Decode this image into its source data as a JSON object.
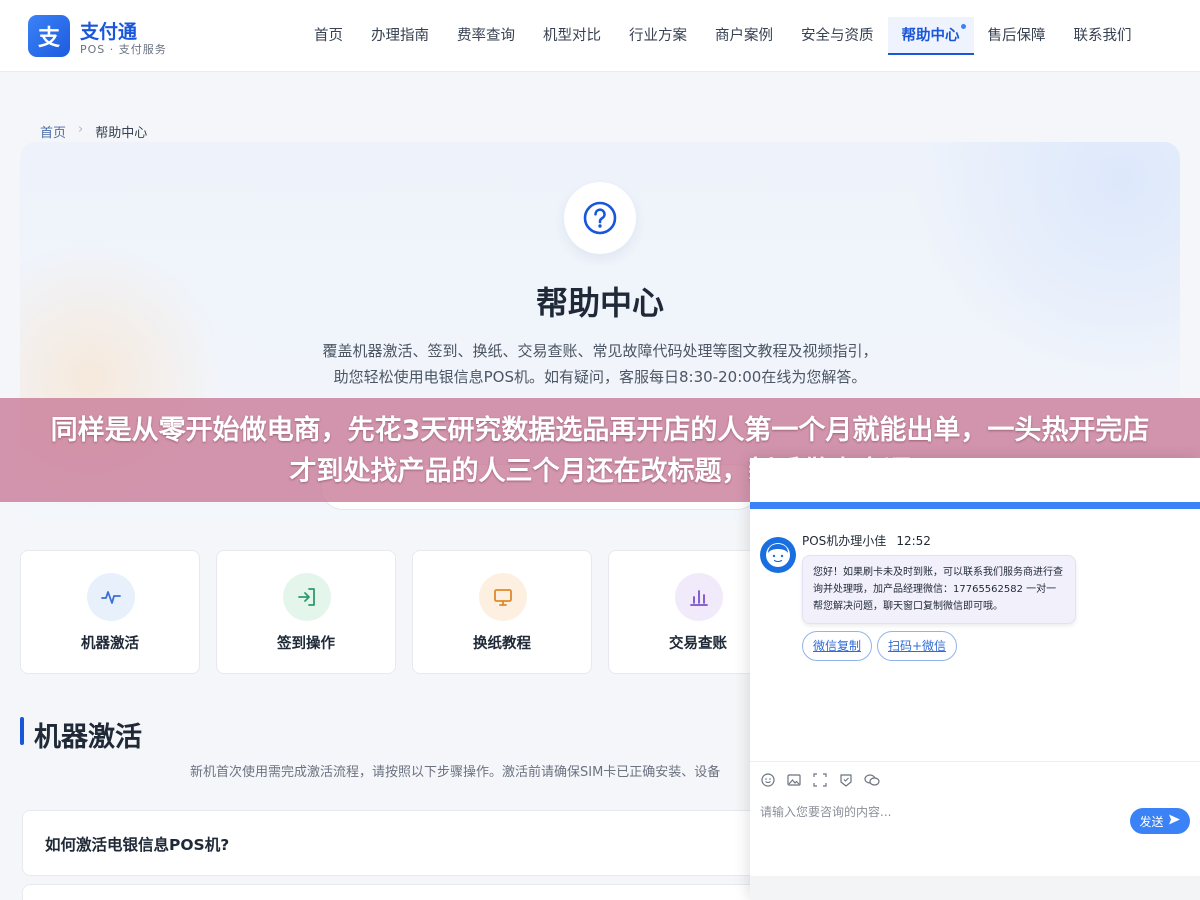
{
  "header": {
    "logo_glyph": "支",
    "logo_title": "支付通",
    "logo_subtitle": "POS · 支付服务",
    "nav": [
      {
        "label": "首页"
      },
      {
        "label": "办理指南"
      },
      {
        "label": "费率查询"
      },
      {
        "label": "机型对比"
      },
      {
        "label": "行业方案"
      },
      {
        "label": "商户案例"
      },
      {
        "label": "安全与资质"
      },
      {
        "label": "帮助中心",
        "active": true
      },
      {
        "label": "售后保障"
      },
      {
        "label": "联系我们"
      }
    ]
  },
  "breadcrumb": {
    "home": "首页",
    "separator": "›",
    "current": "帮助中心"
  },
  "hero": {
    "icon": "question-circle-icon",
    "title": "帮助中心",
    "desc_line1": "覆盖机器激活、签到、换纸、交易查账、常见故障代码处理等图文教程及视频指引，",
    "desc_line2": "助您轻松使用电银信息POS机。如有疑问，客服每日8:30-20:00在线为您解答。"
  },
  "banner": {
    "text": "同样是从零开始做电商，先花3天研究数据选品再开店的人第一个月就能出单，一头热开完店才到处找产品的人三个月还在改标题，新手做电商顺"
  },
  "categories": [
    {
      "label": "机器激活",
      "icon": "pulse-icon",
      "color": "#3b6fd6",
      "bg": "#e8f0fc"
    },
    {
      "label": "签到操作",
      "icon": "sign-in-icon",
      "color": "#2e9b6a",
      "bg": "#e4f5ec"
    },
    {
      "label": "换纸教程",
      "icon": "monitor-icon",
      "color": "#e0892b",
      "bg": "#fdf0e1"
    },
    {
      "label": "交易查账",
      "icon": "bar-chart-icon",
      "color": "#7b4fd0",
      "bg": "#f1eafb"
    }
  ],
  "section": {
    "title": "机器激活",
    "desc": "新机首次使用需完成激活流程，请按照以下步骤操作。激活前请确保SIM卡已正确安装、设备"
  },
  "faq": [
    {
      "question": "如何激活电银信息POS机?"
    }
  ],
  "chat": {
    "minimize": "—",
    "maximize": "□",
    "agent_name": "POS机办理小佳",
    "time": "12:52",
    "message": "您好！如果刷卡未及时到账，可以联系我们服务商进行查询并处理哦，加产品经理微信：17765562582 一对一帮您解决问题，聊天窗口复制微信即可哦。",
    "btn_copy": "微信复制",
    "btn_scan": "扫码+微信",
    "input_placeholder": "请输入您要咨询的内容...",
    "send_label": "发送",
    "toolbar_icons": [
      "emoji-icon",
      "image-icon",
      "screenshot-icon",
      "evaluate-icon",
      "wechat-icon"
    ],
    "accent": "#3b82f6"
  }
}
